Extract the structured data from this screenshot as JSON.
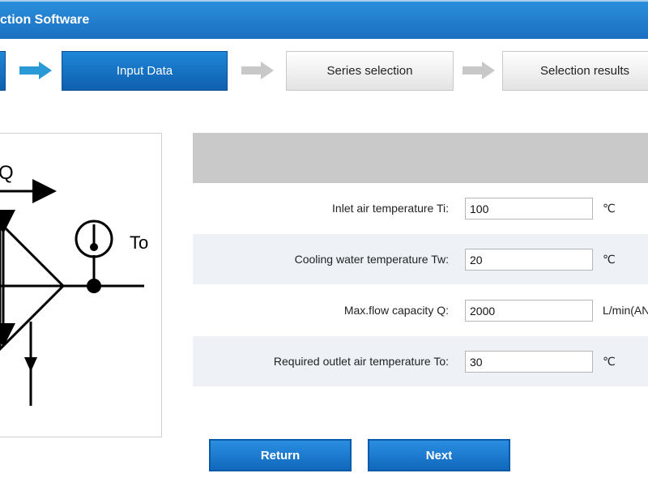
{
  "window": {
    "title": "ction Software"
  },
  "steps": [
    {
      "label": "Input Data",
      "state": "active"
    },
    {
      "label": "Series selection",
      "state": "inactive"
    },
    {
      "label": "Selection results",
      "state": "inactive"
    }
  ],
  "diagram": {
    "flow_label": "Q",
    "outlet_label": "To"
  },
  "form": {
    "rows": [
      {
        "label": "Inlet air temperature Ti:",
        "value": "100",
        "unit": "℃"
      },
      {
        "label": "Cooling water temperature Tw:",
        "value": "20",
        "unit": "℃"
      },
      {
        "label": "Max.flow capacity Q:",
        "value": "2000",
        "unit": "L/min(AN"
      },
      {
        "label": "Required outlet air temperature To:",
        "value": "30",
        "unit": "℃"
      }
    ]
  },
  "buttons": {
    "return_label": "Return",
    "next_label": "Next"
  },
  "colors": {
    "primary_blue": "#1c6fc0",
    "step_arrow_active": "#2a9ad6",
    "step_arrow_inactive": "#c8c8c8",
    "header_gray": "#c9c9c9",
    "row_shade": "#eef1f6"
  }
}
